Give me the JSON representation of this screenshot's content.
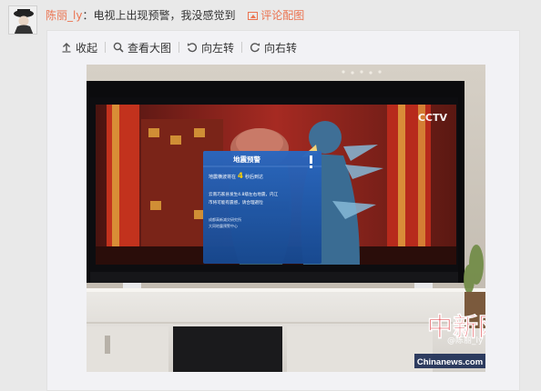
{
  "post": {
    "author": "陈丽_ly",
    "separator": "：",
    "text": "电视上出现预警，我没感觉到",
    "comment_pic": "评论配图"
  },
  "toolbar": {
    "collapse": "收起",
    "view_large": "查看大图",
    "rotate_left": "向左转",
    "rotate_right": "向右转"
  },
  "photo": {
    "channel_logo": "CCTV",
    "alert": {
      "title": "地震预警",
      "countdown_prefix": "地震横波将在",
      "countdown_value": "4",
      "countdown_suffix": "秒后到达",
      "message_line1": "云南巧家县发生4.8级左右地震，内江",
      "message_line2": "市将可能有震感，请合理避险",
      "source_line1": "成都高新减灾研究所",
      "source_line2": "大同地震预警中心"
    },
    "weibo_watermark": "@陈丽_ly",
    "news_logo_cn": "中新网",
    "news_logo_en": "Chinanews.com"
  },
  "colors": {
    "accent": "#eb7350",
    "alert_panel": "#1e56a8",
    "alert_countdown": "#ffd200",
    "news_red": "#d7161d"
  }
}
